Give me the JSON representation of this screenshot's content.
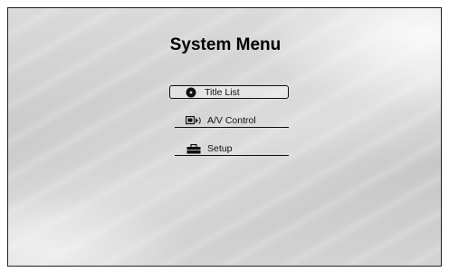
{
  "menu": {
    "title": "System Menu",
    "items": [
      {
        "label": "Title List",
        "icon": "disc-icon",
        "selected": true
      },
      {
        "label": "A/V Control",
        "icon": "av-control-icon",
        "selected": false
      },
      {
        "label": "Setup",
        "icon": "toolbox-icon",
        "selected": false
      }
    ]
  }
}
